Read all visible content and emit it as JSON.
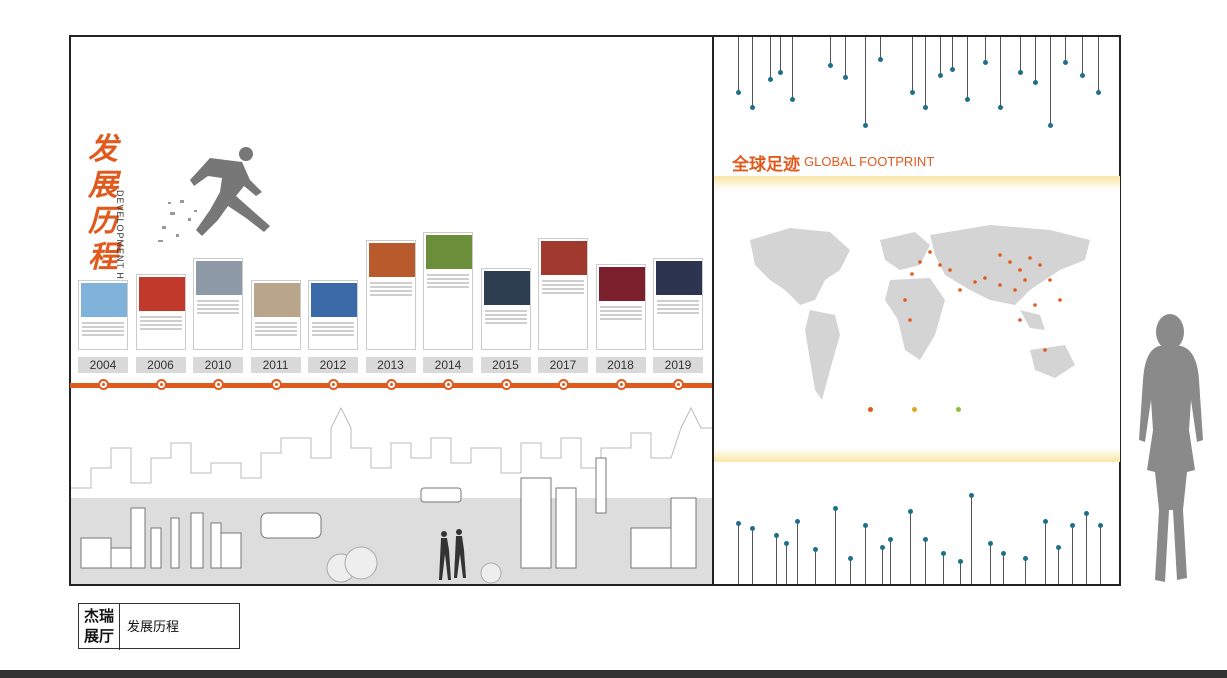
{
  "title": {
    "cn": "发展历程",
    "en": "DEVELOPMENT HISTORY"
  },
  "timeline": {
    "years": [
      "2004",
      "2006",
      "2010",
      "2011",
      "2012",
      "2013",
      "2014",
      "2015",
      "2017",
      "2018",
      "2019"
    ],
    "card_heights": [
      70,
      76,
      92,
      70,
      70,
      110,
      118,
      82,
      112,
      86,
      92
    ],
    "photo_colors": [
      "#7fb3d9",
      "#c0392b",
      "#8e9aa8",
      "#b9a58a",
      "#3b6aa8",
      "#b85a2c",
      "#6b8e3a",
      "#2c3e50",
      "#a13a2e",
      "#7a1f2b",
      "#2c3450"
    ]
  },
  "global": {
    "title_cn": "全球足迹",
    "title_en": "GLOBAL FOOTPRINT"
  },
  "legend": [
    {
      "color": "#e05a1e"
    },
    {
      "color": "#e0a61e"
    },
    {
      "color": "#8fbf3a"
    }
  ],
  "caption": {
    "hall": "杰瑞展厅",
    "name": "发展历程"
  },
  "colors": {
    "accent": "#e05a1e",
    "dot": "#1f6f8b"
  }
}
